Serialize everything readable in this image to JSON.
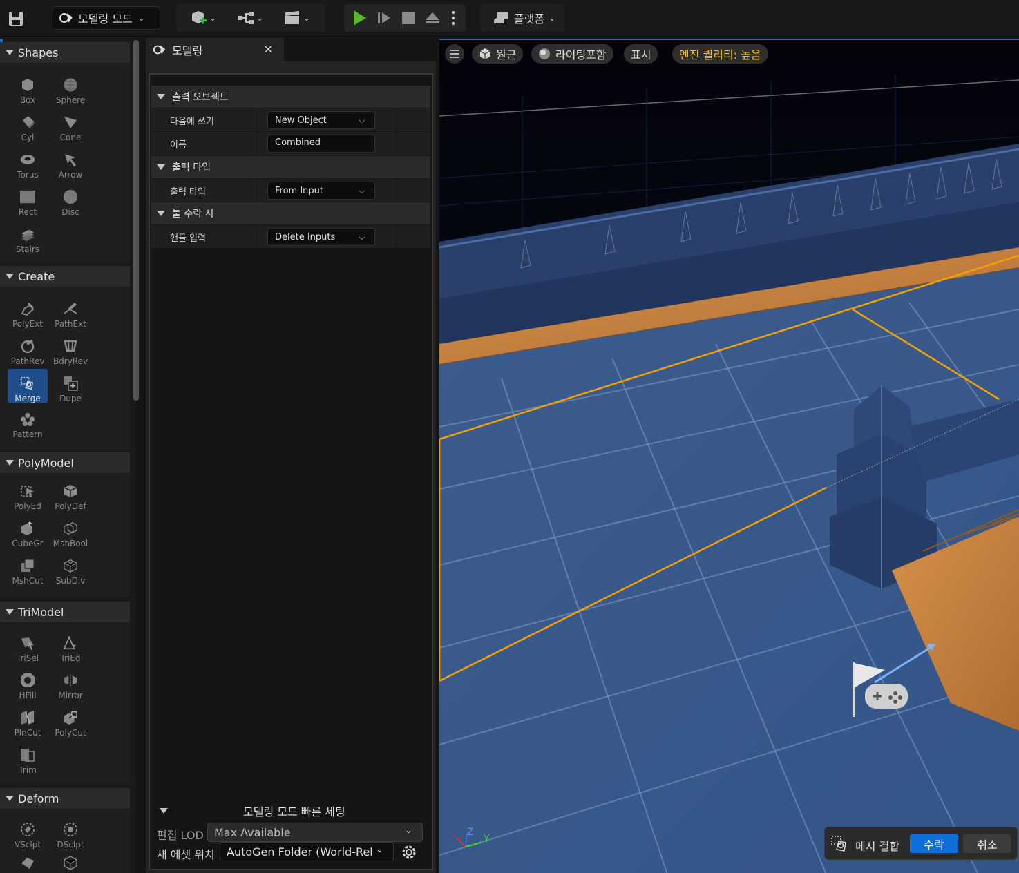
{
  "toolbar": {
    "mode_label": "모델링 모드",
    "platform_label": "플랫폼"
  },
  "palette": {
    "categories": [
      {
        "title": "Shapes",
        "tools": [
          "Box",
          "Sphere",
          "Cyl",
          "Cone",
          "Torus",
          "Arrow",
          "Rect",
          "Disc",
          "Stairs"
        ]
      },
      {
        "title": "Create",
        "tools": [
          "PolyExt",
          "PathExt",
          "PathRev",
          "BdryRev",
          "Merge",
          "Dupe",
          "Pattern"
        ]
      },
      {
        "title": "PolyModel",
        "tools": [
          "PolyEd",
          "PolyDef",
          "CubeGr",
          "MshBool",
          "MshCut",
          "SubDiv"
        ]
      },
      {
        "title": "TriModel",
        "tools": [
          "TriSel",
          "TriEd",
          "HFill",
          "Mirror",
          "PlnCut",
          "PolyCut",
          "Trim"
        ]
      },
      {
        "title": "Deform",
        "tools": [
          "VSclpt",
          "DSclpt"
        ]
      }
    ],
    "active_tool": "Merge"
  },
  "props": {
    "tab_title": "모델링",
    "sections": [
      {
        "title": "출력 오브젝트",
        "rows": [
          {
            "label": "다음에 쓰기",
            "value": "New Object"
          },
          {
            "label": "이름",
            "value": "Combined"
          }
        ]
      },
      {
        "title": "출력 타입",
        "rows": [
          {
            "label": "출력 타입",
            "value": "From Input"
          }
        ]
      },
      {
        "title": "툴 수락 시",
        "rows": [
          {
            "label": "핸들 입력",
            "value": "Delete Inputs"
          }
        ]
      }
    ],
    "quick_settings": {
      "title": "모델링 모드 빠른 세팅",
      "lod_label": "편집 LOD",
      "lod_value": "Max Available",
      "asset_label": "새 에셋 위치",
      "asset_value": "AutoGen Folder (World-Rel"
    }
  },
  "viewport": {
    "perspective": "원근",
    "lighting": "라이팅포함",
    "show": "표시",
    "quality": "엔진 퀄리티: 높음",
    "axis_z": "Z",
    "axis_y": "Y",
    "merge_label": "메시 결합",
    "accept": "수락",
    "cancel": "취소"
  },
  "colors": {
    "accent": "#0e6fd8",
    "play_green": "#5ab52e",
    "selection_orange": "#f5a100",
    "quality_yellow": "#f2c21b"
  }
}
